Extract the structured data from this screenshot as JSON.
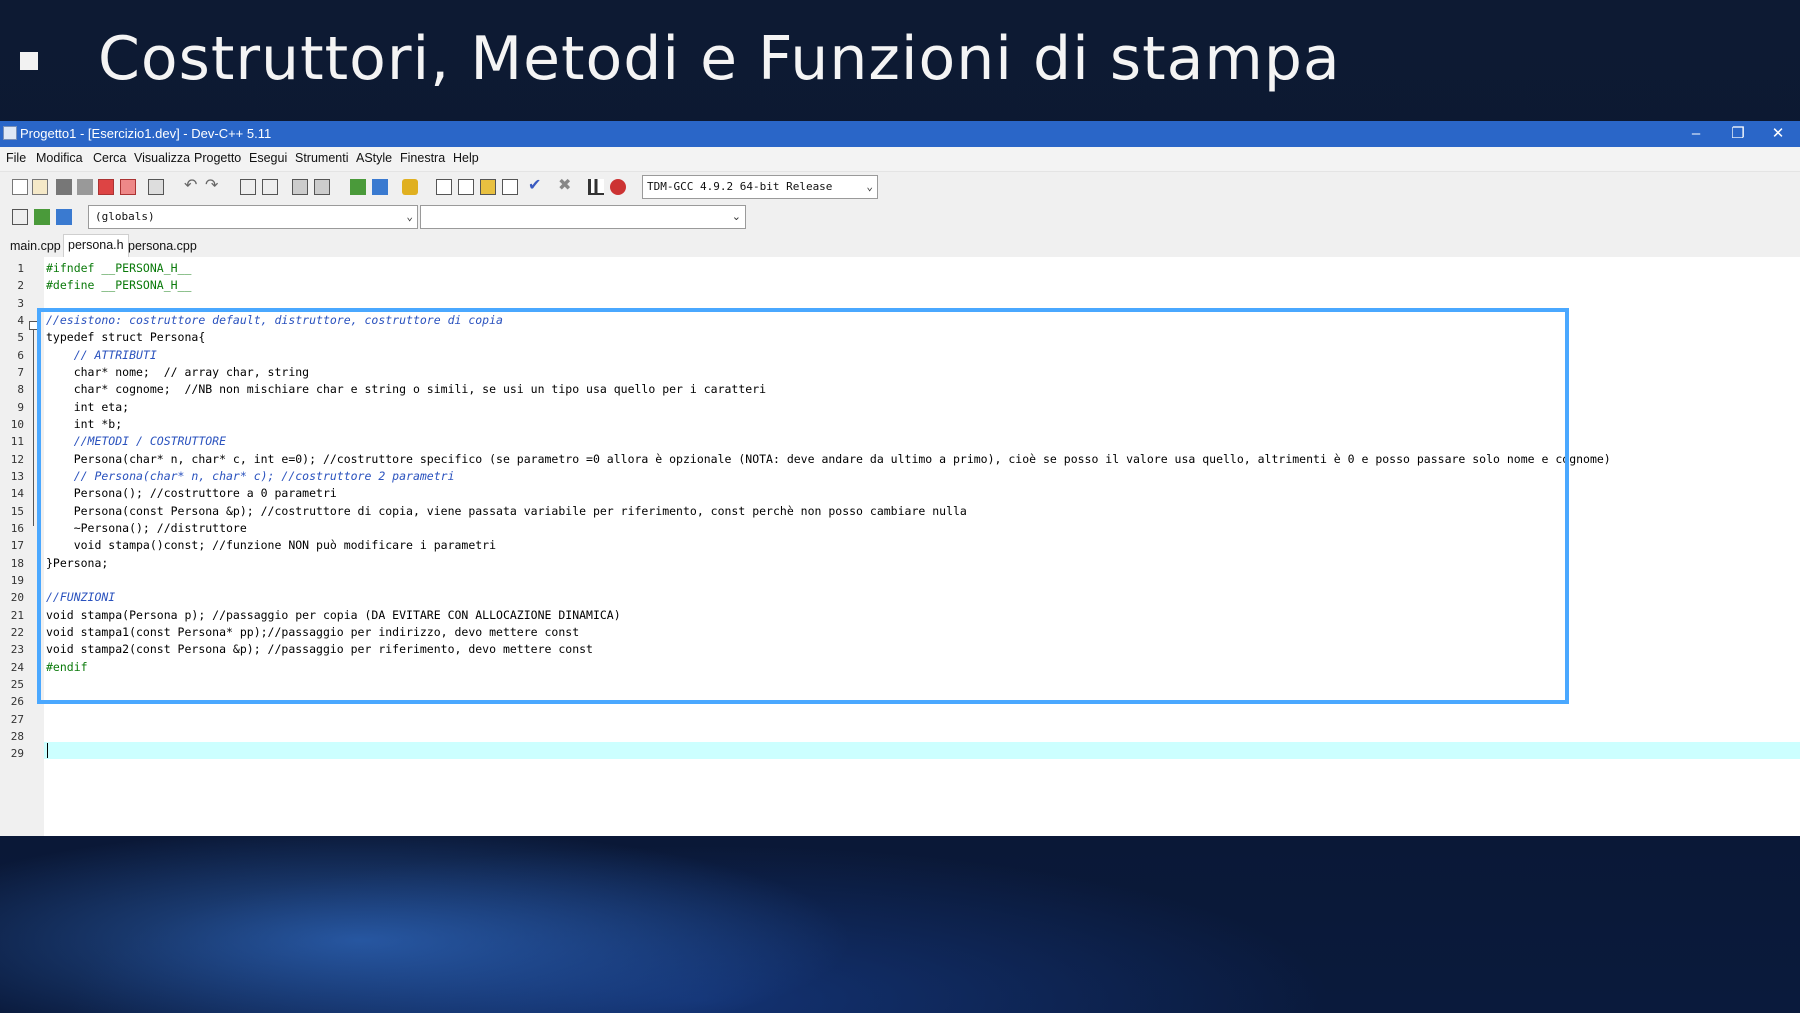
{
  "slide": {
    "title": "Costruttori, Metodi e Funzioni di stampa"
  },
  "window": {
    "title": "Progetto1 - [Esercizio1.dev] - Dev-C++ 5.11",
    "minimize": "–",
    "restore": "❐",
    "close": "✕"
  },
  "menu": [
    "File",
    "Modifica",
    "Cerca",
    "Visualizza",
    "Progetto",
    "Esegui",
    "Strumenti",
    "AStyle",
    "Finestra",
    "Help"
  ],
  "toolbar": {
    "compiler": "TDM-GCC 4.9.2 64-bit Release",
    "scope": "(globals)",
    "members": ""
  },
  "tabs": [
    "main.cpp",
    "persona.h",
    "persona.cpp"
  ],
  "active_tab": "persona.h",
  "line_numbers": [
    "1",
    "2",
    "3",
    "4",
    "5",
    "6",
    "7",
    "8",
    "9",
    "10",
    "11",
    "12",
    "13",
    "14",
    "15",
    "16",
    "17",
    "18",
    "19",
    "20",
    "21",
    "22",
    "23",
    "24",
    "25",
    "26",
    "27",
    "28",
    "29"
  ],
  "code": [
    "#ifndef __PERSONA_H__",
    "#define __PERSONA_H__",
    "",
    "//esistono: costruttore default, distruttore, costruttore di copia",
    "typedef struct Persona{",
    "    // ATTRIBUTI",
    "    char* nome;  // array char, string",
    "    char* cognome;  //NB non mischiare char e string o simili, se usi un tipo usa quello per i caratteri",
    "    int eta;",
    "    int *b;",
    "    //METODI / COSTRUTTORE",
    "    Persona(char* n, char* c, int e=0); //costruttore specifico (se parametro =0 allora è opzionale (NOTA: deve andare da ultimo a primo), cioè se posso il valore usa quello, altrimenti è 0 e posso passare solo nome e cognome)",
    "    // Persona(char* n, char* c); //costruttore 2 parametri",
    "    Persona(); //costruttore a 0 parametri",
    "    Persona(const Persona &p); //costruttore di copia, viene passata variabile per riferimento, const perchè non posso cambiare nulla",
    "    ~Persona(); //distruttore",
    "    void stampa()const; //funzione NON può modificare i parametri",
    "}Persona;",
    "",
    "//FUNZIONI",
    "void stampa(Persona p); //passaggio per copia (DA EVITARE CON ALLOCAZIONE DINAMICA)",
    "void stampa1(const Persona* pp);//passaggio per indirizzo, devo mettere const",
    "void stampa2(const Persona &p); //passaggio per riferimento, devo mettere const",
    "#endif",
    "",
    "",
    "",
    "",
    ""
  ],
  "colors": {
    "titlebar": "#2a66c8",
    "highlight": "#4aa8ff",
    "comment": "#2a52be",
    "keyword": "#00008b",
    "current_line": "#ccffff"
  }
}
